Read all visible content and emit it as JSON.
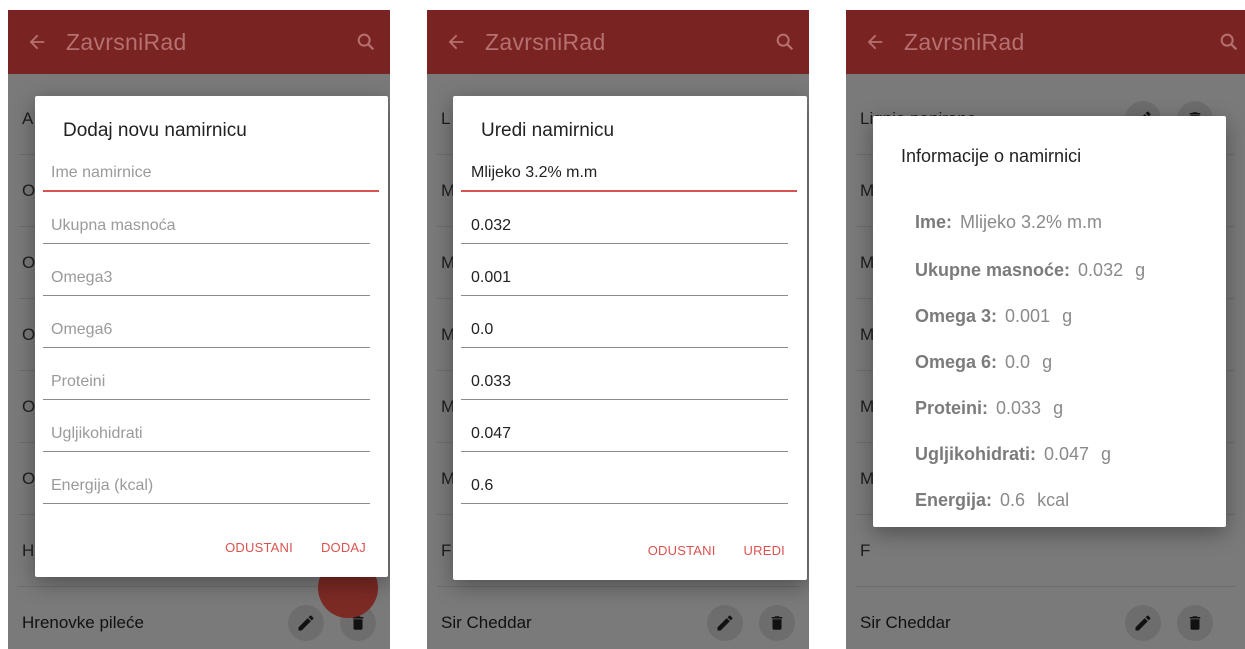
{
  "app": {
    "title": "ZavrsniRad"
  },
  "panel1": {
    "list_partial_items": [
      "A",
      "O",
      "O",
      "O",
      "O",
      "O",
      "H"
    ],
    "bottom_item": "Hrenovke pileće",
    "dialog": {
      "title": "Dodaj novu namirnicu",
      "fields": [
        {
          "placeholder": "Ime namirnice"
        },
        {
          "placeholder": "Ukupna masnoća"
        },
        {
          "placeholder": "Omega3"
        },
        {
          "placeholder": "Omega6"
        },
        {
          "placeholder": "Proteini"
        },
        {
          "placeholder": "Ugljikohidrati"
        },
        {
          "placeholder": "Energija (kcal)"
        }
      ],
      "cancel_label": "ODUSTANI",
      "confirm_label": "DODAJ"
    }
  },
  "panel2": {
    "list_partial_items": [
      "L",
      "M",
      "M",
      "M",
      "M",
      "M",
      "F"
    ],
    "bottom_item": "Sir Cheddar",
    "dialog": {
      "title": "Uredi namirnicu",
      "fields": [
        {
          "value": "Mlijeko 3.2% m.m"
        },
        {
          "value": "0.032"
        },
        {
          "value": "0.001"
        },
        {
          "value": "0.0"
        },
        {
          "value": "0.033"
        },
        {
          "value": "0.047"
        },
        {
          "value": "0.6"
        }
      ],
      "cancel_label": "ODUSTANI",
      "confirm_label": "UREDI"
    }
  },
  "panel3": {
    "top_item": "Lignje panirane",
    "list_partial_items": [
      "M",
      "M",
      "M",
      "M",
      "M",
      "F"
    ],
    "bottom_item": "Sir Cheddar",
    "dialog": {
      "title": "Informacije o namirnici",
      "rows": [
        {
          "label": "Ime:",
          "value": "Mlijeko 3.2% m.m",
          "unit": ""
        },
        {
          "label": "Ukupne masnoće:",
          "value": "0.032",
          "unit": "g"
        },
        {
          "label": "Omega 3:",
          "value": "0.001",
          "unit": "g"
        },
        {
          "label": "Omega 6:",
          "value": "0.0",
          "unit": "g"
        },
        {
          "label": "Proteini:",
          "value": "0.033",
          "unit": "g"
        },
        {
          "label": "Ugljikohidrati:",
          "value": "0.047",
          "unit": "g"
        },
        {
          "label": "Energija:",
          "value": "0.6",
          "unit": "kcal"
        }
      ]
    }
  },
  "colors": {
    "accent": "#d9534f",
    "appbar_dimmed": "#7a2323",
    "scrim_background": "#7a7a7a"
  },
  "icons": [
    "back-arrow-icon",
    "search-icon",
    "pencil-icon",
    "trash-icon"
  ]
}
